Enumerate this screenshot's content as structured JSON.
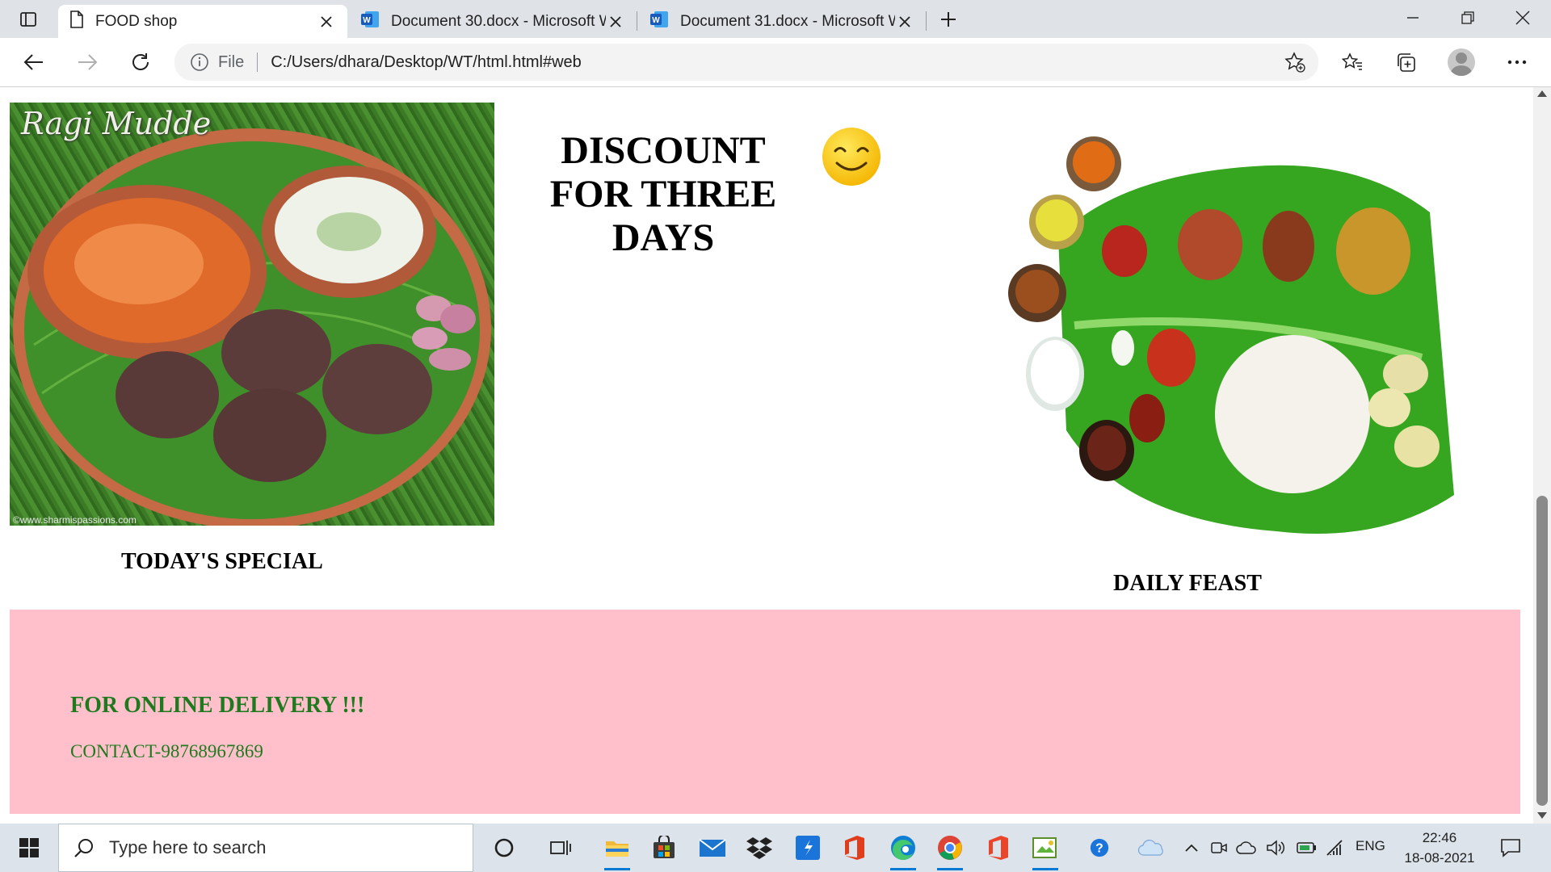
{
  "browser": {
    "tabs": [
      {
        "title": "FOOD shop",
        "icon": "page-icon",
        "active": true
      },
      {
        "title": "Document 30.docx - Microsoft W",
        "icon": "word-icon",
        "active": false
      },
      {
        "title": "Document 31.docx - Microsoft W",
        "icon": "word-icon",
        "active": false
      }
    ],
    "address": {
      "scheme": "File",
      "url": "C:/Users/dhara/Desktop/WT/html.html#web"
    }
  },
  "page": {
    "ragi_image": {
      "watermark": "Ragi Mudde",
      "credit": "©www.sharmispassions.com"
    },
    "discount_heading": "DISCOUNT FOR THREE DAYS",
    "today_special": "TODAY'S SPECIAL",
    "daily_feast": "DAILY FEAST",
    "delivery": {
      "title": "FOR ONLINE DELIVERY !!!",
      "contact": "CONTACT-98768967869",
      "background_color": "#ffc0cb",
      "text_color": "#1f7a1f"
    }
  },
  "taskbar": {
    "search_placeholder": "Type here to search",
    "language": "ENG",
    "time": "22:46",
    "date": "18-08-2021",
    "pinned_apps": [
      "cortana-icon",
      "task-view-icon",
      "file-explorer-icon",
      "store-icon",
      "mail-icon",
      "dropbox-icon",
      "swift-icon",
      "office-icon",
      "edge-icon",
      "chrome-icon",
      "office-alt-icon",
      "sway-icon"
    ]
  }
}
